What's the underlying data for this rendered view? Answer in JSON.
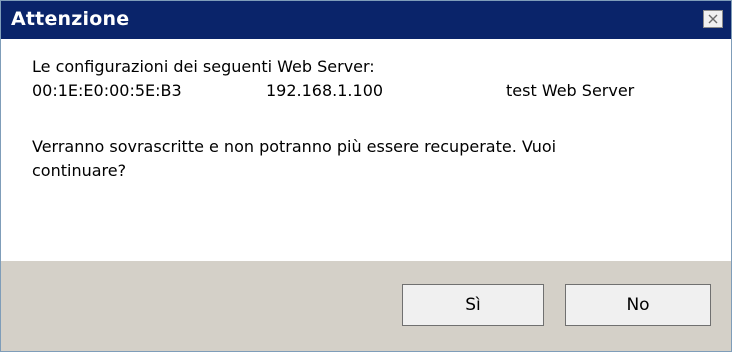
{
  "window": {
    "title": "Attenzione",
    "close_icon": "close-icon"
  },
  "message": {
    "line1": "Le configurazioni dei seguenti Web Server:",
    "server": {
      "mac": "00:1E:E0:00:5E:B3",
      "ip": "192.168.1.100",
      "name": "test Web Server"
    },
    "line3": "Verranno sovrascritte e non potranno più essere recuperate. Vuoi",
    "line4": "continuare?"
  },
  "buttons": {
    "yes": "Sì",
    "no": "No"
  },
  "colors": {
    "titlebar": "#0a246a",
    "footer": "#d4d0c8",
    "button": "#f0f0f0"
  }
}
